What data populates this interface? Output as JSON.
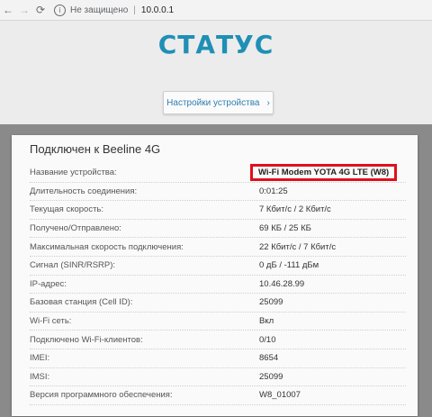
{
  "browser": {
    "security_text": "Не защищено",
    "url": "10.0.0.1"
  },
  "page": {
    "title": "СТАТУС",
    "settings_button": "Настройки устройства",
    "panel_title": "Подключен к Beeline 4G",
    "rows": [
      {
        "label": "Название устройства:",
        "value": "Wi-Fi Modem YOTA 4G LTE (W8)"
      },
      {
        "label": "Длительность соединения:",
        "value": "0:01:25"
      },
      {
        "label": "Текущая скорость:",
        "value": "7 Кбит/с / 2 Кбит/с"
      },
      {
        "label": "Получено/Отправлено:",
        "value": "69 КБ / 25 КБ"
      },
      {
        "label": "Максимальная скорость подключения:",
        "value": "22 Кбит/с / 7 Кбит/с"
      },
      {
        "label": "Сигнал (SINR/RSRP):",
        "value": "0 дБ / -111 дБм"
      },
      {
        "label": "IP-адрес:",
        "value": "10.46.28.99"
      },
      {
        "label": "Базовая станция (Cell ID):",
        "value": "25099"
      },
      {
        "label": "Wi-Fi сеть:",
        "value": "Вкл"
      },
      {
        "label": "Подключено Wi-Fi-клиентов:",
        "value": "0/10"
      },
      {
        "label": "IMEI:",
        "value": "8654"
      },
      {
        "label": "IMSI:",
        "value": "25099"
      },
      {
        "label": "Версия программного обеспечения:",
        "value": "W8_01007"
      }
    ]
  },
  "colors": {
    "accent": "#1f8fb5",
    "highlight_border": "#e0101d"
  }
}
